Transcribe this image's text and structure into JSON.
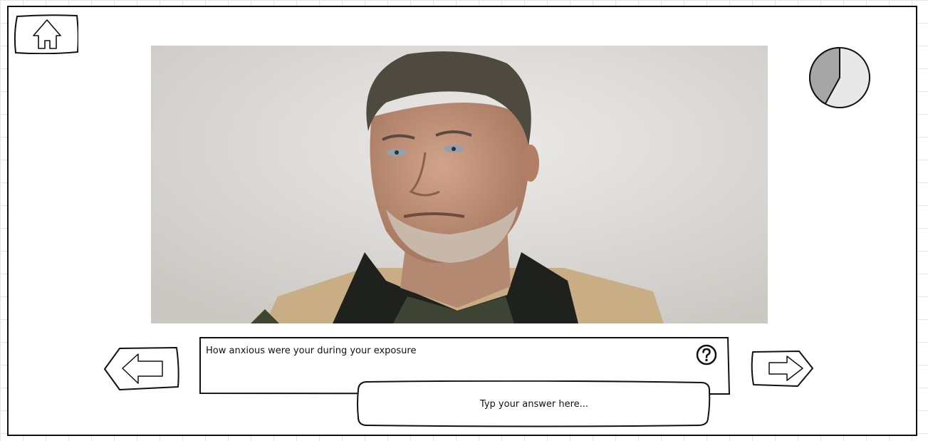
{
  "question": {
    "text": "How anxious were your during your exposure"
  },
  "answer": {
    "placeholder": "Typ your answer here...",
    "value": ""
  },
  "progress": {
    "fraction": 0.42,
    "filled_color": "#a6a6a6",
    "remaining_color": "#e8e8e8"
  },
  "icons": {
    "home": "home-icon",
    "help": "question-mark-icon",
    "previous": "arrow-left-icon",
    "next": "arrow-right-icon"
  },
  "photo": {
    "subject": "portrait-of-man"
  }
}
